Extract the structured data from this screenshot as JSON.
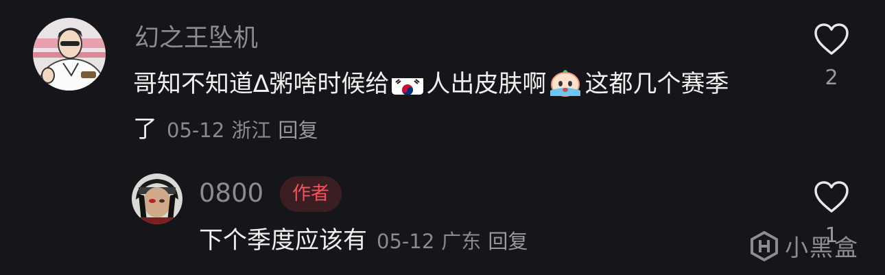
{
  "comments": [
    {
      "username": "幻之王坠机",
      "text_a": "哥知不知道∆粥啥时候给",
      "flag_icon": "south-korea-flag-icon",
      "text_b": "人出皮肤啊",
      "emoji_icon": "crying-face-emoji-icon",
      "text_c": "这都几个赛季了",
      "date": "05-12",
      "location": "浙江",
      "reply_label": "回复",
      "like_count": "2"
    },
    {
      "username": "0800",
      "badge": "作者",
      "text": "下个季度应该有",
      "date": "05-12",
      "location": "广东",
      "reply_label": "回复",
      "like_count": "1"
    }
  ],
  "watermark": {
    "text": "小黑盒"
  },
  "colors": {
    "background": "#16161a",
    "username": "#8c8c8e",
    "badge_text": "#f2535d",
    "badge_bg": "#3a1e21"
  }
}
